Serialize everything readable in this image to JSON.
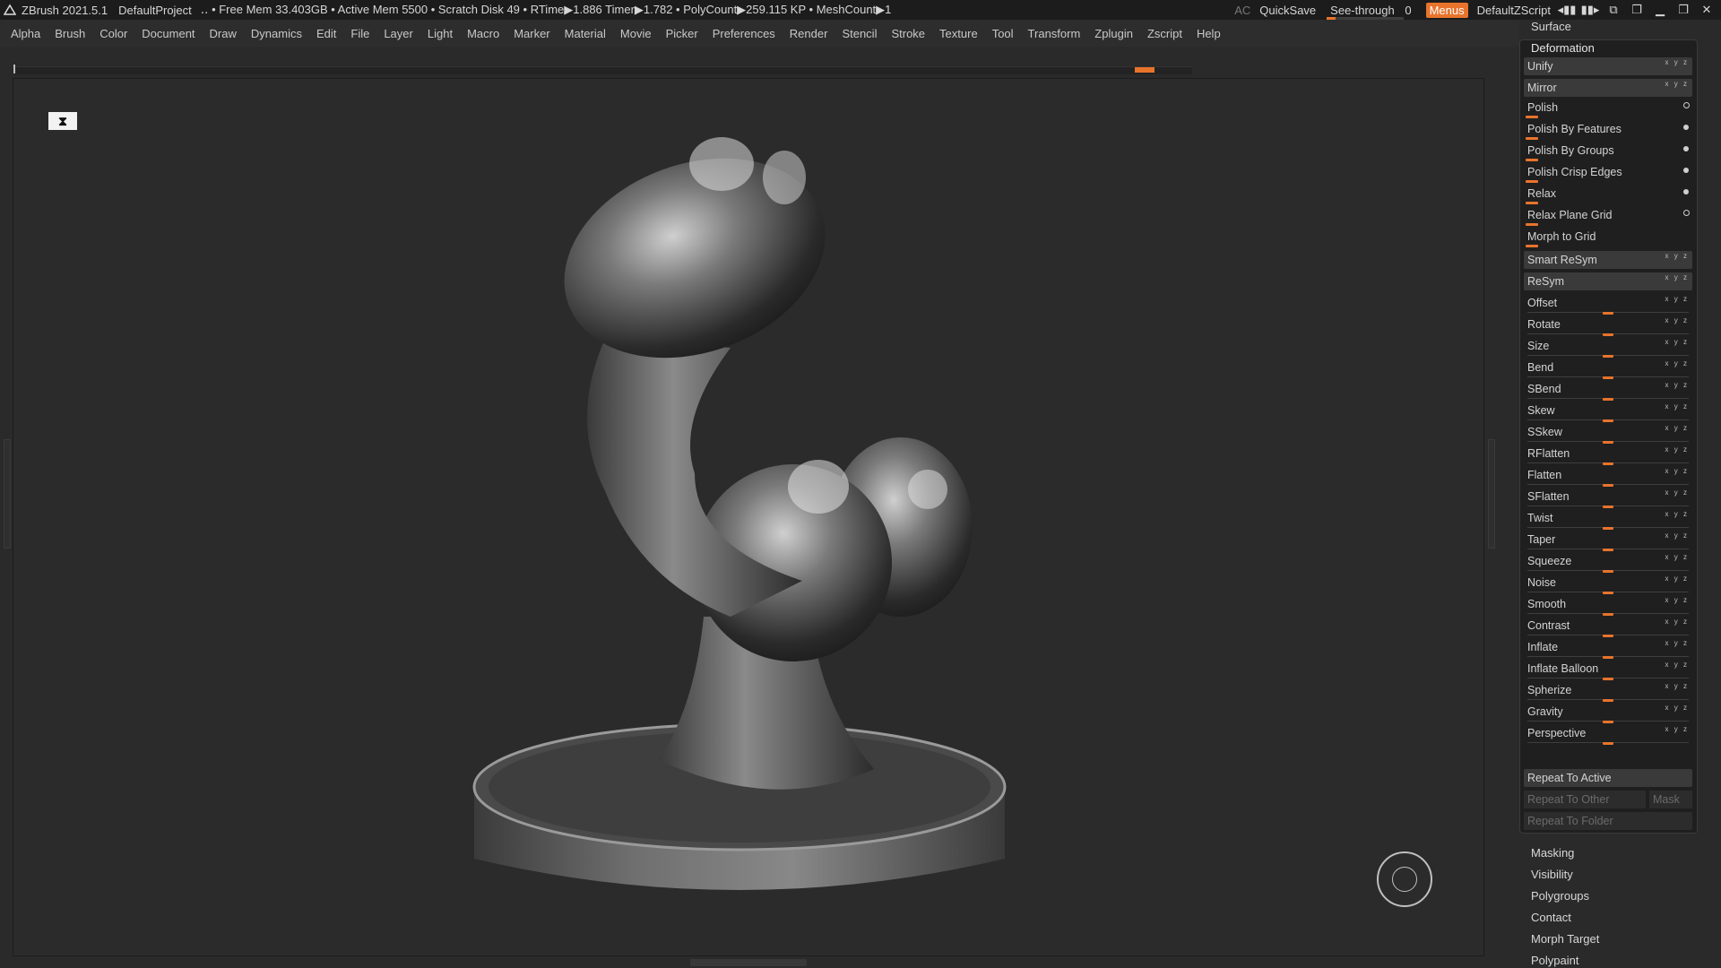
{
  "titlebar": {
    "app": "ZBrush 2021.5.1",
    "project": "DefaultProject",
    "status": "‥ • Free Mem 33.403GB • Active Mem 5500 • Scratch Disk 49 •  RTime▶1.886 Timer▶1.782 • PolyCount▶259.115 KP  • MeshCount▶1",
    "ac": "AC",
    "quicksave": "QuickSave",
    "see_through_label": "See-through",
    "see_through_value": "0",
    "menus": "Menus",
    "zscript": "DefaultZScript"
  },
  "menubar": [
    "Alpha",
    "Brush",
    "Color",
    "Document",
    "Draw",
    "Dynamics",
    "Edit",
    "File",
    "Layer",
    "Light",
    "Macro",
    "Marker",
    "Material",
    "Movie",
    "Picker",
    "Preferences",
    "Render",
    "Stencil",
    "Stroke",
    "Texture",
    "Tool",
    "Transform",
    "Zplugin",
    "Zscript",
    "Help"
  ],
  "palette": {
    "surface": "Surface",
    "deformation_title": "Deformation",
    "buttons_top": [
      {
        "label": "Unify",
        "xyz": "x y z"
      },
      {
        "label": "Mirror",
        "xyz": "x y z"
      }
    ],
    "polish_items": [
      {
        "label": "Polish",
        "marker": "ring"
      },
      {
        "label": "Polish By Features",
        "marker": "dot"
      },
      {
        "label": "Polish By Groups",
        "marker": "dot"
      },
      {
        "label": "Polish Crisp Edges",
        "marker": "dot"
      },
      {
        "label": "Relax",
        "marker": "dot"
      },
      {
        "label": "Relax Plane Grid",
        "marker": "ring"
      },
      {
        "label": "Morph to Grid",
        "marker": "none"
      }
    ],
    "buttons_mid": [
      {
        "label": "Smart ReSym",
        "xyz": "x y z"
      },
      {
        "label": "ReSym",
        "xyz": "x y z"
      }
    ],
    "sliders": [
      {
        "label": "Offset",
        "xyz": "x y z"
      },
      {
        "label": "Rotate",
        "xyz": "x y z"
      },
      {
        "label": "Size",
        "xyz": "x y z"
      },
      {
        "label": "Bend",
        "xyz": "x y z"
      },
      {
        "label": "SBend",
        "xyz": "x y z"
      },
      {
        "label": "Skew",
        "xyz": "x y z"
      },
      {
        "label": "SSkew",
        "xyz": "x y z"
      },
      {
        "label": "RFlatten",
        "xyz": "x y z"
      },
      {
        "label": "Flatten",
        "xyz": "x y z"
      },
      {
        "label": "SFlatten",
        "xyz": "x y z"
      },
      {
        "label": "Twist",
        "xyz": "x y z"
      },
      {
        "label": "Taper",
        "xyz": "x y z"
      },
      {
        "label": "Squeeze",
        "xyz": "x y z"
      },
      {
        "label": "Noise",
        "xyz": "x y z"
      },
      {
        "label": "Smooth",
        "xyz": "x y z"
      },
      {
        "label": "Contrast",
        "xyz": "x y z"
      },
      {
        "label": "Inflate",
        "xyz": "x y z"
      },
      {
        "label": "Inflate Balloon",
        "xyz": "x y z"
      },
      {
        "label": "Spherize",
        "xyz": "x y z"
      },
      {
        "label": "Gravity",
        "xyz": "x y z"
      },
      {
        "label": "Perspective",
        "xyz": "x y z"
      }
    ],
    "repeat_to_active": "Repeat To Active",
    "repeat_to_other": "Repeat To Other",
    "mask": "Mask",
    "repeat_to_folder": "Repeat To Folder",
    "subpalettes": [
      "Masking",
      "Visibility",
      "Polygroups",
      "Contact",
      "Morph Target",
      "Polypaint"
    ]
  },
  "colors": {
    "accent": "#e8742c",
    "background": "#2a2a2a"
  }
}
